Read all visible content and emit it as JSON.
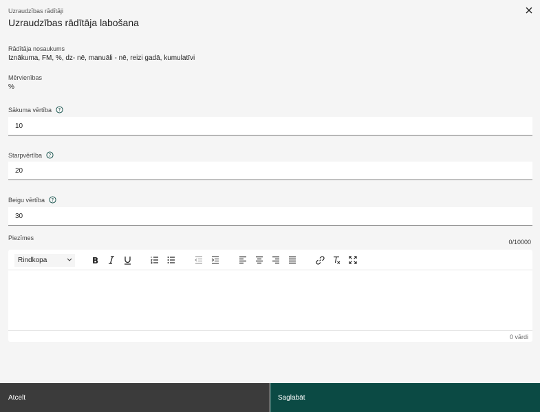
{
  "header": {
    "breadcrumb": "Uzraudzības rādītāji",
    "title": "Uzraudzības rādītāja labošana",
    "close_icon": "close-icon"
  },
  "readonly": {
    "name_label": "Rādītāja nosaukums",
    "name_value": "Iznākuma, FM, %, dz- nē, manuāli - nē, reizi gadā, kumulatīvi",
    "unit_label": "Mērvienības",
    "unit_value": "%"
  },
  "fields": {
    "start": {
      "label": "Sākuma vērtība",
      "value": "10"
    },
    "intermediate": {
      "label": "Starpvērtība",
      "value": "20"
    },
    "end": {
      "label": "Beigu vērtība",
      "value": "30"
    }
  },
  "notes": {
    "label": "Piezīmes",
    "counter": "0/10000",
    "format_value": "Rindkopa",
    "word_count": "0 vārdi",
    "toolbar_icons": [
      "bold-icon",
      "italic-icon",
      "underline-icon",
      "ordered-list-icon",
      "bullet-list-icon",
      "outdent-icon",
      "indent-icon",
      "align-left-icon",
      "align-center-icon",
      "align-right-icon",
      "align-justify-icon",
      "link-icon",
      "clear-format-icon",
      "fullscreen-icon"
    ]
  },
  "footer": {
    "cancel_label": "Atcelt",
    "save_label": "Saglabāt"
  },
  "colors": {
    "background": "#f5f5f5",
    "cancel_bg": "#3b3b3b",
    "save_bg": "#0b4a44",
    "help_icon": "#0b4a44"
  }
}
